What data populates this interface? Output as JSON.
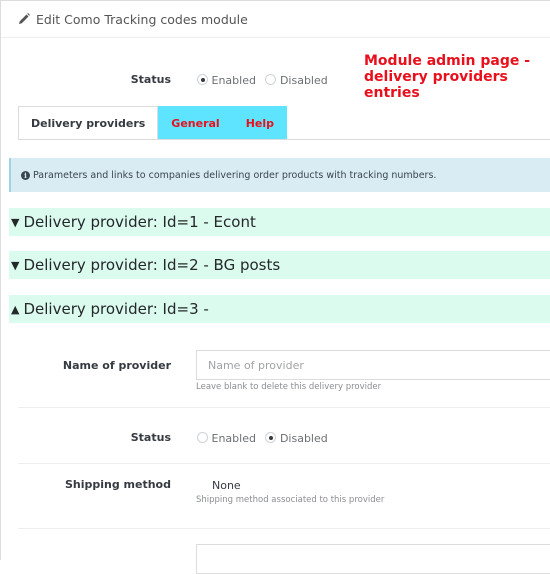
{
  "panel": {
    "title": "Edit Como Tracking codes module",
    "title_icon": "pencil-icon"
  },
  "status": {
    "label": "Status",
    "options": [
      "Enabled",
      "Disabled"
    ],
    "selected": "Enabled"
  },
  "annotation": "Module admin page - delivery providers entries",
  "tabs": [
    {
      "label": "Delivery providers",
      "active": true
    },
    {
      "label": "General",
      "active": false
    },
    {
      "label": "Help",
      "active": false
    }
  ],
  "info": {
    "icon": "info-circle-icon",
    "text": "Parameters and links to companies delivering order products with tracking numbers."
  },
  "providers": [
    {
      "label": "Delivery provider: Id=1 - Econt",
      "expanded": false,
      "caret": "▼"
    },
    {
      "label": "Delivery provider: Id=2 - BG posts",
      "expanded": false,
      "caret": "▼"
    },
    {
      "label": "Delivery provider: Id=3 -",
      "expanded": true,
      "caret": "▲"
    }
  ],
  "form": {
    "name": {
      "label": "Name of provider",
      "placeholder": "Name of provider",
      "value": "",
      "help": "Leave blank to delete this delivery provider"
    },
    "status": {
      "label": "Status",
      "options": [
        "Enabled",
        "Disabled"
      ],
      "selected": "Disabled"
    },
    "shipping": {
      "label": "Shipping method",
      "value": "None",
      "help": "Shipping method associated to this provider"
    }
  }
}
